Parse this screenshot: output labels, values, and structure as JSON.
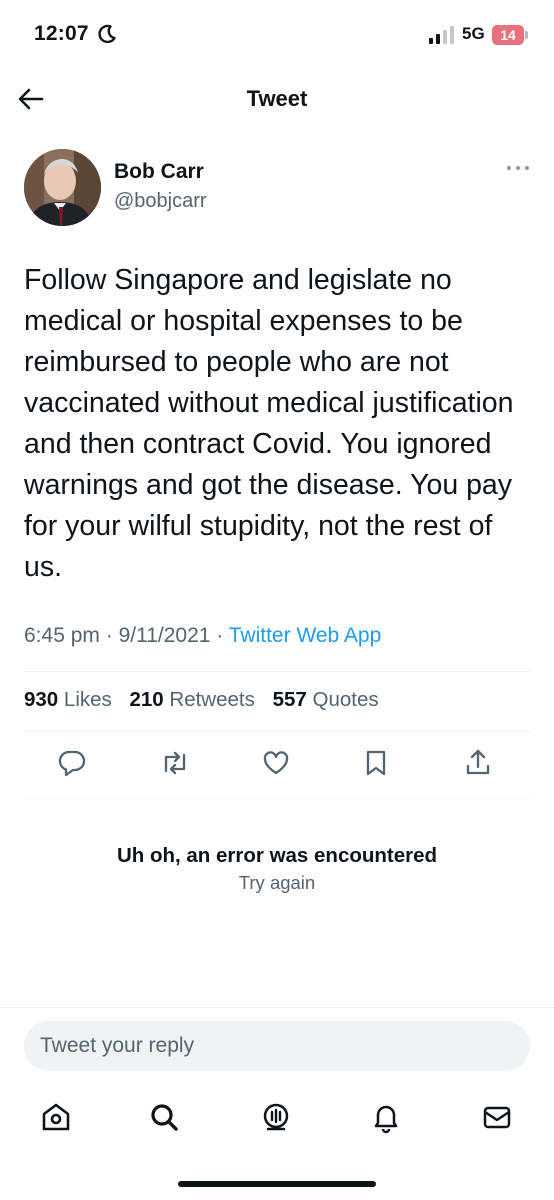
{
  "status_bar": {
    "time": "12:07",
    "network": "5G",
    "battery": "14",
    "moon_icon": "moon-icon",
    "signal_icon": "signal-bars-icon"
  },
  "header": {
    "title": "Tweet",
    "back_icon": "arrow-left-icon"
  },
  "tweet": {
    "author": {
      "name": "Bob Carr",
      "handle": "@bobjcarr"
    },
    "more_icon": "more-horizontal-icon",
    "text": "Follow Singapore and legislate no medical or hospital expenses to be reimbursed to people who are not vaccinated without medical justification and then contract Covid. You ignored warnings and got the disease. You pay for your wilful stupidity, not the rest of us.",
    "time": "6:45 pm",
    "date": "9/11/2021",
    "source": "Twitter Web App",
    "separator": "·"
  },
  "stats": {
    "likes_count": "930",
    "likes_label": "Likes",
    "retweets_count": "210",
    "retweets_label": "Retweets",
    "quotes_count": "557",
    "quotes_label": "Quotes"
  },
  "actions": [
    "reply-icon",
    "retweet-icon",
    "like-icon",
    "bookmark-icon",
    "share-icon"
  ],
  "error": {
    "title": "Uh oh, an error was encountered",
    "retry": "Try again"
  },
  "reply": {
    "placeholder": "Tweet your reply"
  },
  "bottom_nav": [
    "home-icon",
    "search-icon",
    "spaces-icon",
    "notifications-icon",
    "messages-icon"
  ],
  "colors": {
    "text": "#0f1419",
    "secondary": "#536471",
    "link": "#1d9bf0",
    "battery_low": "#e8717d"
  }
}
